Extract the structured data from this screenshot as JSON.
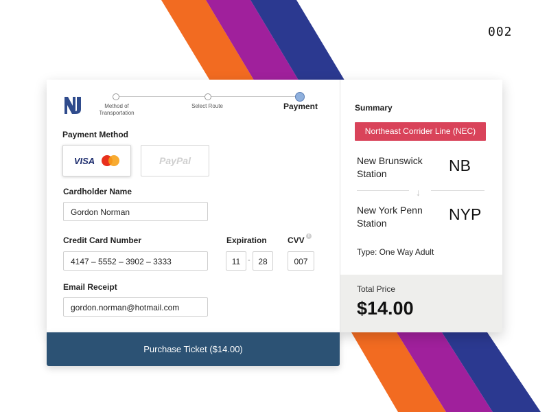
{
  "shot_number": "002",
  "logo": {
    "text": "NJ"
  },
  "stepper": {
    "steps": [
      {
        "label": "Method of\nTransportation"
      },
      {
        "label": "Select Route"
      },
      {
        "label": "Payment"
      }
    ],
    "active_index": 2
  },
  "payment": {
    "label": "Payment Method",
    "options": [
      {
        "name": "VISA",
        "selected": true
      },
      {
        "name": "PayPal",
        "selected": false
      }
    ]
  },
  "cardholder": {
    "label": "Cardholder Name",
    "value": "Gordon Norman"
  },
  "credit_card": {
    "label": "Credit Card Number",
    "value": "4147 – 5552 – 3902 – 3333"
  },
  "expiration": {
    "label": "Expiration",
    "month": "11",
    "separator": "-",
    "year": "28"
  },
  "cvv": {
    "label": "CVV",
    "value": "007",
    "info_icon": "i"
  },
  "email": {
    "label": "Email Receipt",
    "value": "gordon.norman@hotmail.com"
  },
  "purchase_button": "Purchase Ticket ($14.00)",
  "summary": {
    "title": "Summary",
    "line": "Northeast Corrider Line (NEC)",
    "origin": {
      "name": "New Brunswick Station",
      "code": "NB"
    },
    "destination": {
      "name": "New York Penn Station",
      "code": "NYP"
    },
    "type": "Type: One Way Adult",
    "total_label": "Total Price",
    "total_value": "$14.00"
  },
  "colors": {
    "stripe_orange": "#f26b21",
    "stripe_magenta": "#a0209c",
    "stripe_navy": "#2b3990",
    "line_badge": "#d9435a",
    "purchase_button": "#2c5274",
    "logo_blue": "#2f4b8c"
  }
}
